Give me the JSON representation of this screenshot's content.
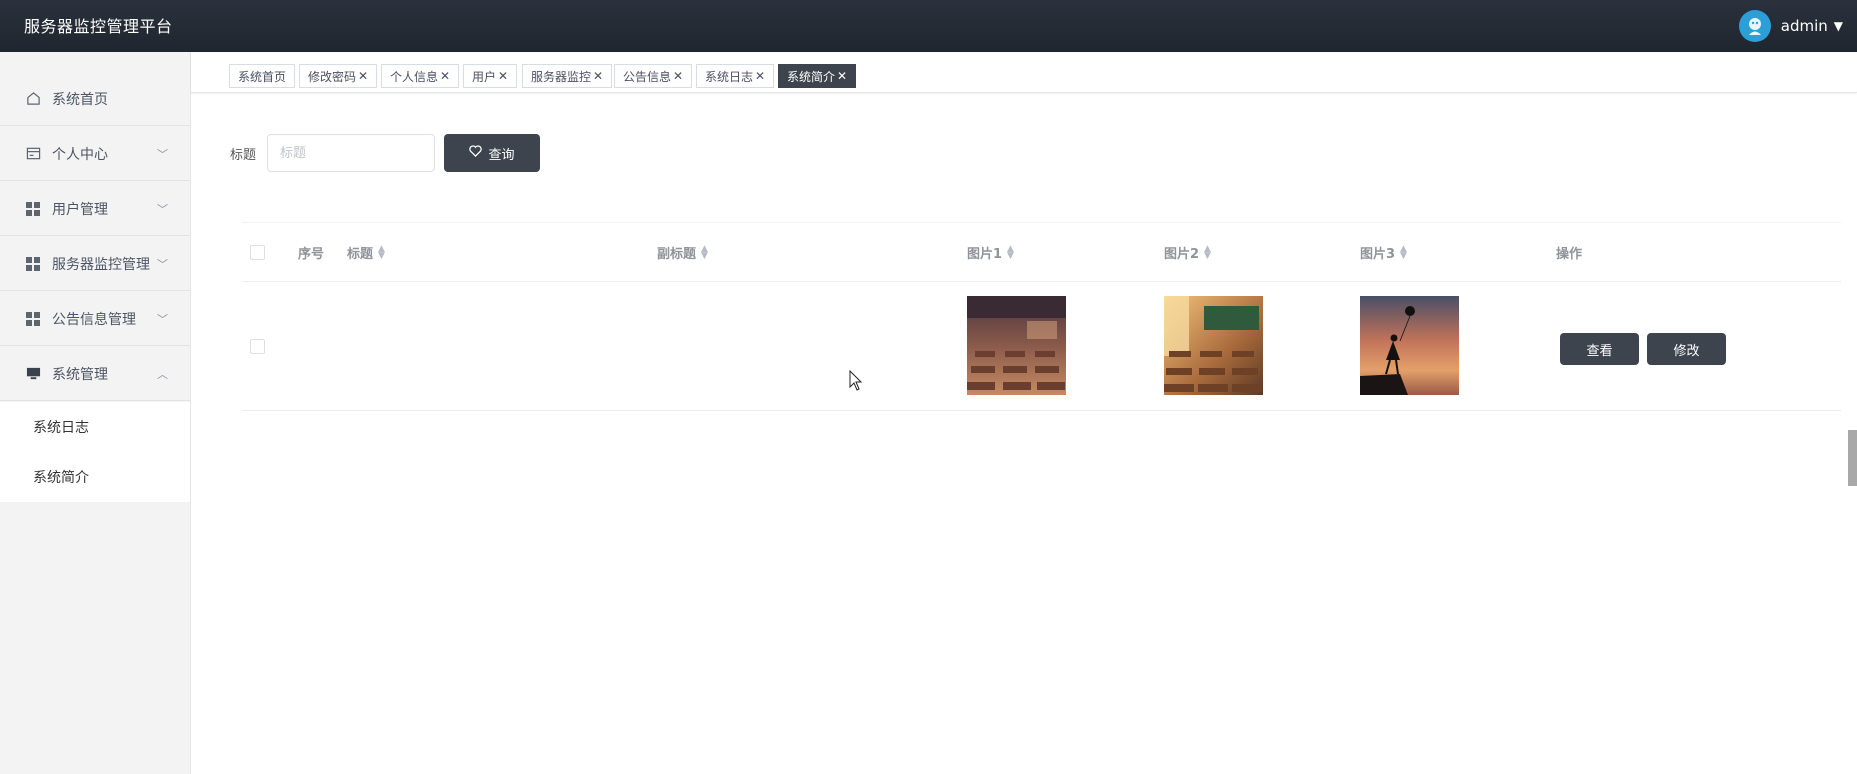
{
  "header": {
    "title": "服务器监控管理平台",
    "username": "admin"
  },
  "sidebar": {
    "items": [
      {
        "label": "系统首页",
        "icon": "home-icon",
        "expandable": false
      },
      {
        "label": "个人中心",
        "icon": "card-icon",
        "expandable": true
      },
      {
        "label": "用户管理",
        "icon": "grid-icon",
        "expandable": true
      },
      {
        "label": "服务器监控管理",
        "icon": "grid-icon",
        "expandable": true
      },
      {
        "label": "公告信息管理",
        "icon": "grid-icon",
        "expandable": true
      },
      {
        "label": "系统管理",
        "icon": "monitor-icon",
        "expandable": true,
        "expanded": true
      }
    ],
    "subitems": [
      "系统日志",
      "系统简介"
    ]
  },
  "tabs": [
    {
      "label": "系统首页",
      "closable": false
    },
    {
      "label": "修改密码",
      "closable": true
    },
    {
      "label": "个人信息",
      "closable": true
    },
    {
      "label": "用户",
      "closable": true
    },
    {
      "label": "服务器监控",
      "closable": true
    },
    {
      "label": "公告信息",
      "closable": true
    },
    {
      "label": "系统日志",
      "closable": true
    },
    {
      "label": "系统简介",
      "closable": true,
      "active": true
    }
  ],
  "search": {
    "label": "标题",
    "placeholder": "标题",
    "value": "",
    "button_label": "查询"
  },
  "table": {
    "columns": [
      "序号",
      "标题",
      "副标题",
      "图片1",
      "图片2",
      "图片3",
      "操作"
    ],
    "rows": [
      {
        "index": "",
        "title": "",
        "subtitle": "",
        "images": [
          "classroom-dusk-image",
          "classroom-sunlit-image",
          "girl-balloon-silhouette-image"
        ],
        "actions": [
          "查看",
          "修改"
        ]
      }
    ]
  },
  "colors": {
    "topbar": "#252b34",
    "accent": "#3d444d",
    "sidebar_bg": "#f3f3f3"
  }
}
